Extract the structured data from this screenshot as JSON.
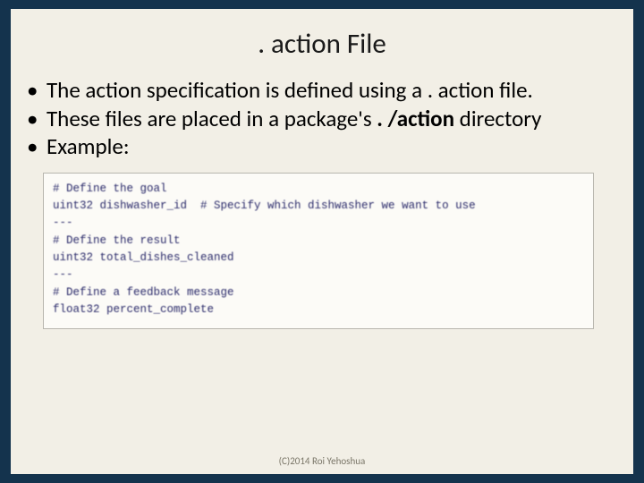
{
  "title": ". action File",
  "bullets": [
    {
      "pre": "The action specification is defined using a . action file.",
      "bold": "",
      "post": ""
    },
    {
      "pre": "These files are placed in a package's ",
      "bold": ". /action",
      "post": " directory"
    },
    {
      "pre": "Example:",
      "bold": "",
      "post": ""
    }
  ],
  "code": [
    "# Define the goal",
    "uint32 dishwasher_id  # Specify which dishwasher we want to use",
    "---",
    "# Define the result",
    "uint32 total_dishes_cleaned",
    "---",
    "# Define a feedback message",
    "float32 percent_complete"
  ],
  "footer": "(C)2014 Roi Yehoshua"
}
